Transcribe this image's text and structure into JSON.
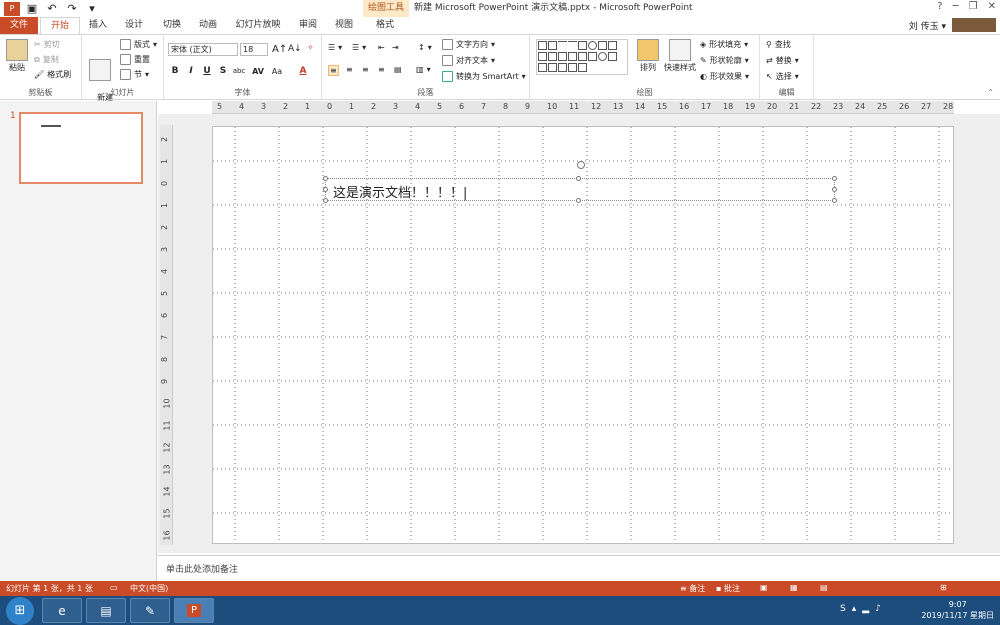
{
  "titlebar": {
    "context_tools": "绘图工具",
    "window_title": "新建 Microsoft PowerPoint 演示文稿.pptx - Microsoft PowerPoint",
    "help": "?",
    "minimize": "─",
    "restore": "❐",
    "close": "✕"
  },
  "tabs": [
    "文件",
    "开始",
    "插入",
    "设计",
    "切换",
    "动画",
    "幻灯片放映",
    "审阅",
    "视图",
    "格式"
  ],
  "user": {
    "name": "刘 传玉 ▾"
  },
  "ribbon": {
    "clipboard": {
      "paste": "粘贴",
      "cut": "剪切",
      "copy": "复制",
      "format_painter": "格式刷",
      "label": "剪贴板"
    },
    "slides": {
      "new_slide": "新建\n幻灯片",
      "layout": "版式",
      "reset": "重置",
      "section": "节",
      "label": "幻灯片"
    },
    "font": {
      "name": "宋体 (正文)",
      "size": "18",
      "bold": "B",
      "italic": "I",
      "underline": "U",
      "strike": "S",
      "shadow": "abc",
      "spacing": "AV",
      "case": "Aa",
      "color": "A",
      "label": "字体"
    },
    "paragraph": {
      "text_direction": "文字方向",
      "align_text": "对齐文本",
      "smartart": "转换为 SmartArt",
      "label": "段落"
    },
    "drawing": {
      "arrange": "排列",
      "quick_styles": "快速样式",
      "fill": "形状填充",
      "outline": "形状轮廓",
      "effects": "形状效果",
      "label": "绘图"
    },
    "editing": {
      "find": "查找",
      "replace": "替换",
      "select": "选择",
      "label": "编辑"
    }
  },
  "thumbnails": {
    "slide_number": "1"
  },
  "ruler": {
    "h": [
      "5",
      "4",
      "3",
      "2",
      "1",
      "0",
      "1",
      "2",
      "3",
      "4",
      "5",
      "6",
      "7",
      "8",
      "9",
      "10",
      "11",
      "12",
      "13",
      "14",
      "15",
      "16",
      "17",
      "18",
      "19",
      "20",
      "21",
      "22",
      "23",
      "24",
      "25",
      "26",
      "27",
      "28"
    ],
    "v": [
      "2",
      "1",
      "0",
      "1",
      "2",
      "3",
      "4",
      "5",
      "6",
      "7",
      "8",
      "9",
      "10",
      "11",
      "12",
      "13",
      "14",
      "15",
      "16"
    ]
  },
  "slide": {
    "text": "这是演示文档！！！！|"
  },
  "notes": {
    "placeholder": "单击此处添加备注"
  },
  "status": {
    "slide_info": "幻灯片 第 1 张，共 1 张",
    "language": "中文(中国)",
    "notes": "备注",
    "comments": "批注"
  },
  "taskbar": {
    "time": "9:07",
    "date": "2019/11/17 星期日"
  }
}
